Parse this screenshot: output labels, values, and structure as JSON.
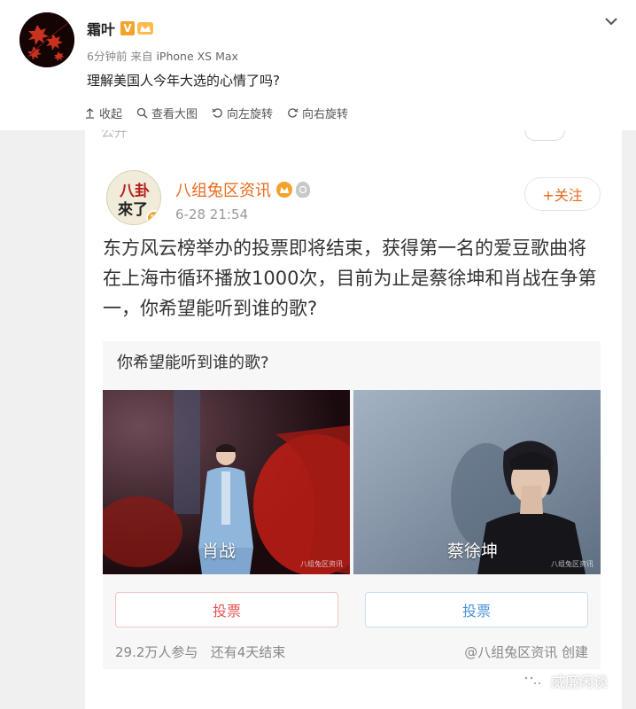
{
  "post": {
    "author": "霜叶",
    "vip_badge": "V",
    "time": "6分钟前",
    "source_prefix": "来自",
    "source": "iPhone XS Max",
    "text": "理解美国人今年大选的心情了吗?"
  },
  "actions": [
    {
      "icon": "collapse-icon",
      "label": "收起"
    },
    {
      "icon": "search-icon",
      "label": "查看大图"
    },
    {
      "icon": "rotate-left-icon",
      "label": "向左旋转"
    },
    {
      "icon": "rotate-right-icon",
      "label": "向右旋转"
    }
  ],
  "inner": {
    "remnant_text": "公开",
    "avatar_text": "八卦 來了",
    "account": "八组兔区资讯",
    "time": "6-28 21:54",
    "follow_label": "+关注",
    "body": "东方风云榜举办的投票即将结束，获得第一名的爱豆歌曲将在上海市循环播放1000次，目前为止是蔡徐坤和肖战在争第一，你希望能听到谁的歌?",
    "vote": {
      "question": "你希望能听到谁的歌?",
      "options": [
        {
          "name": "肖战",
          "button": "投票"
        },
        {
          "name": "蔡徐坤",
          "button": "投票"
        }
      ],
      "image_watermark": "八组兔区资讯",
      "participants": "29.2万人参与",
      "remaining": "还有4天结束",
      "creator": "@八组兔区资讯 创建"
    }
  },
  "watermark": {
    "text": "威廉闲谈"
  },
  "colors": {
    "accent_orange": "#e86b1c",
    "vote_red": "#e55353",
    "vote_blue": "#4b92d9",
    "vip_gold": "#f2a329"
  }
}
